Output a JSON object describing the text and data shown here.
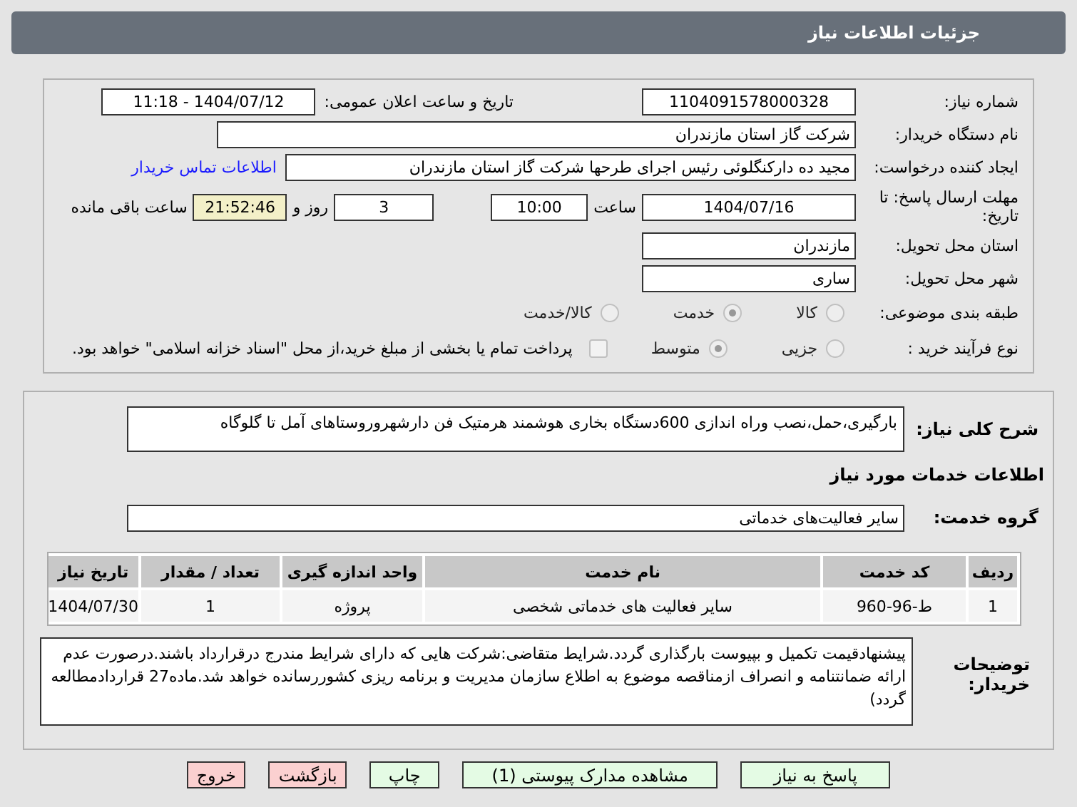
{
  "title": "جزئیات اطلاعات نیاز",
  "need_number": {
    "label": "شماره نیاز:",
    "value": "1104091578000328"
  },
  "announce": {
    "label": "تاریخ و ساعت اعلان عمومی:",
    "value": "1404/07/12 - 11:18"
  },
  "buyer_org": {
    "label": "نام دستگاه خریدار:",
    "value": "شرکت گاز استان مازندران"
  },
  "creator": {
    "label": "ایجاد کننده درخواست:",
    "value": "مجید ده دارکنگلوئی رئیس اجرای طرحها شرکت گاز استان مازندران",
    "link": "اطلاعات تماس خریدار"
  },
  "deadline": {
    "label": "مهلت ارسال پاسخ: تا تاریخ:",
    "date": "1404/07/16",
    "time_label": "ساعت",
    "time": "10:00",
    "days": "3",
    "days_label": "روز و",
    "remaining": "21:52:46",
    "remaining_label": "ساعت باقی مانده"
  },
  "province": {
    "label": "استان محل تحویل:",
    "value": "مازندران"
  },
  "city": {
    "label": "شهر محل تحویل:",
    "value": "ساری"
  },
  "category": {
    "label": "طبقه بندی موضوعی:",
    "options": [
      {
        "label": "کالا",
        "selected": false
      },
      {
        "label": "خدمت",
        "selected": true
      },
      {
        "label": "کالا/خدمت",
        "selected": false
      }
    ]
  },
  "process": {
    "label": "نوع فرآیند خرید :",
    "options": [
      {
        "label": "جزیی",
        "selected": false
      },
      {
        "label": "متوسط",
        "selected": true
      }
    ],
    "treasury": {
      "checked": false,
      "label": "پرداخت تمام یا بخشی از مبلغ خرید،از محل \"اسناد خزانه اسلامی\" خواهد بود."
    }
  },
  "summary": {
    "label": "شرح کلی نیاز:",
    "value": "بارگیری،حمل،نصب وراه اندازی 600دستگاه بخاری هوشمند هرمتیک فن دارشهروروستاهای آمل تا گلوگاه"
  },
  "services_heading": "اطلاعات خدمات مورد نیاز",
  "service_group": {
    "label": "گروه خدمت:",
    "value": "سایر فعالیت‌های خدماتی"
  },
  "table": {
    "columns": [
      "ردیف",
      "کد خدمت",
      "نام خدمت",
      "واحد اندازه گیری",
      "تعداد / مقدار",
      "تاریخ نیاز"
    ],
    "rows": [
      [
        "1",
        "ط-96-960",
        "سایر فعالیت های خدماتی شخصی",
        "پروژه",
        "1",
        "1404/07/30"
      ]
    ]
  },
  "notes": {
    "label": "توضیحات خریدار:",
    "value": "پیشنهادقیمت تکمیل و بپیوست بارگذاری گردد.شرایط متقاضی:شرکت هایی که دارای شرایط مندرج درقرارداد باشند.درصورت عدم ارائه ضمانتنامه و انصراف ازمناقصه موضوع به اطلاع سازمان مدیریت و برنامه ریزی کشوررسانده خواهد شد.ماده27 قراردادمطالعه گردد)"
  },
  "buttons": [
    {
      "label": "پاسخ به نیاز",
      "kind": "primary"
    },
    {
      "label": "مشاهده مدارک پیوستی (1)",
      "kind": "primary"
    },
    {
      "label": "چاپ",
      "kind": "primary"
    },
    {
      "label": "بازگشت",
      "kind": "danger"
    },
    {
      "label": "خروج",
      "kind": "danger"
    }
  ]
}
